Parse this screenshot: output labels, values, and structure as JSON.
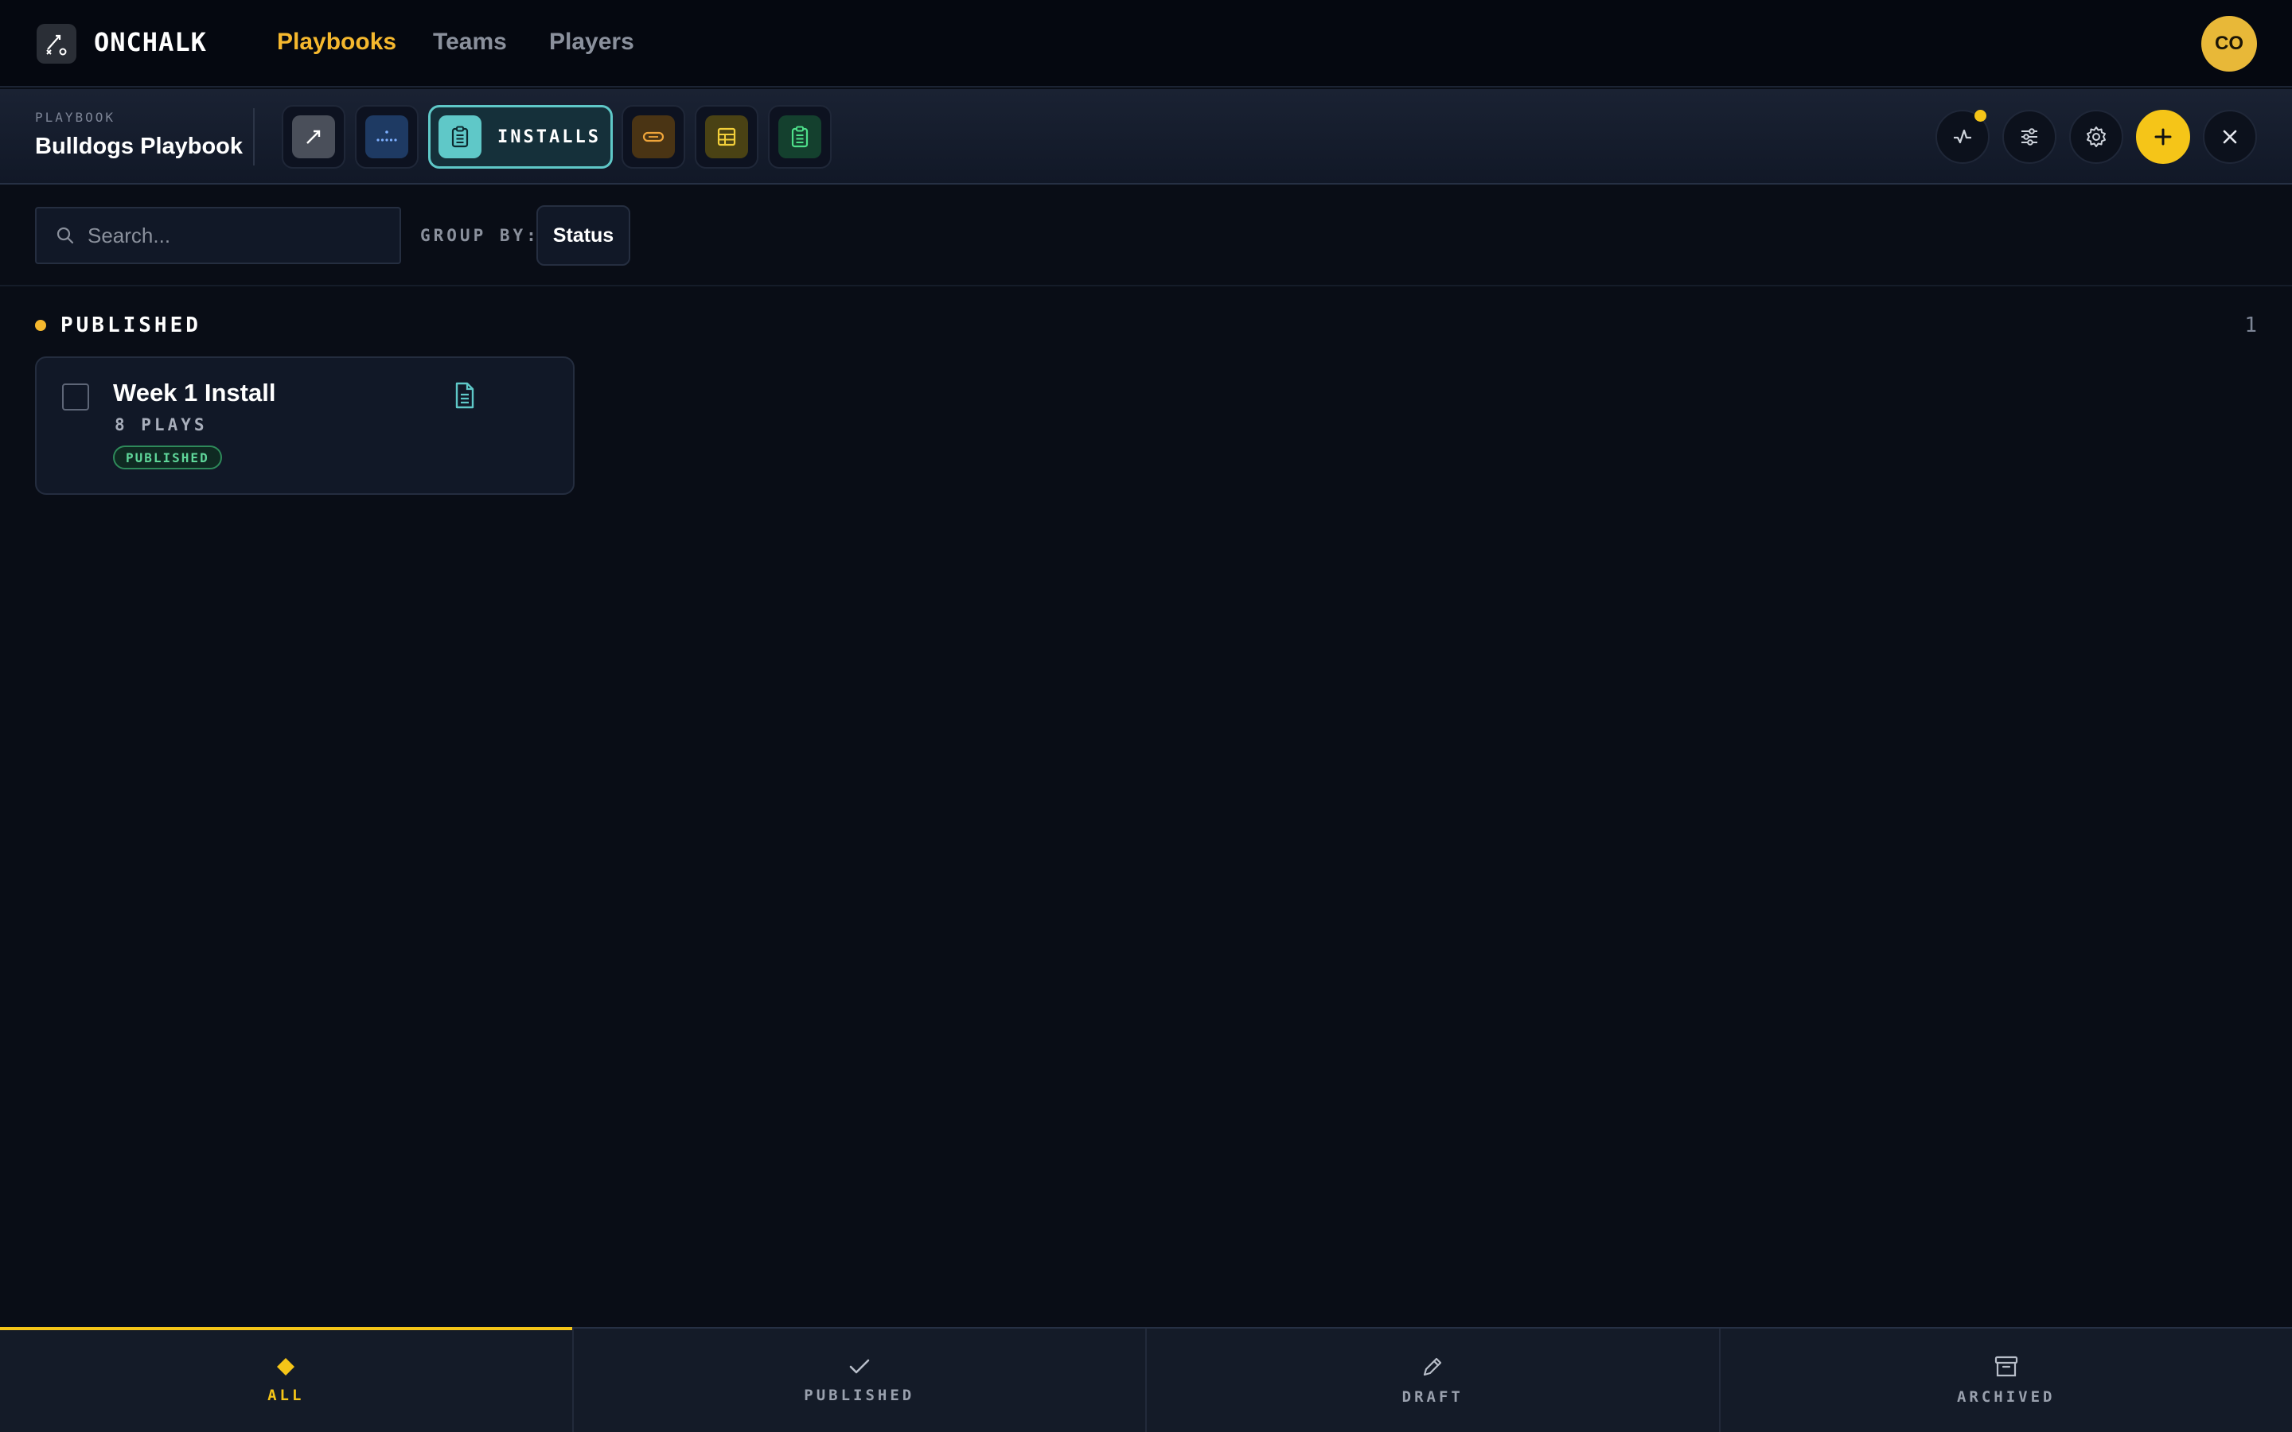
{
  "app": {
    "brand": "ONCHALK",
    "nav": [
      {
        "label": "Playbooks",
        "active": true
      },
      {
        "label": "Teams",
        "active": false
      },
      {
        "label": "Players",
        "active": false
      }
    ],
    "avatar_initials": "CO"
  },
  "toolbar": {
    "eyebrow": "PLAYBOOK",
    "title": "Bulldogs Playbook",
    "tools": [
      {
        "icon": "arrow-pen-icon",
        "color": "#4a4f5a"
      },
      {
        "icon": "formation-icon",
        "color": "#1e3a63"
      },
      {
        "icon": "clipboard-icon",
        "color": "#5fc8c8",
        "label": "INSTALLS",
        "active": true
      },
      {
        "icon": "wristband-icon",
        "color": "#4a3414"
      },
      {
        "icon": "table-icon",
        "color": "#4a4214"
      },
      {
        "icon": "clipboard-list-icon",
        "color": "#14402e"
      }
    ],
    "actions": [
      "activity-icon",
      "sliders-icon",
      "gear-icon",
      "plus-icon",
      "close-icon"
    ]
  },
  "filters": {
    "search_placeholder": "Search...",
    "group_by_label": "GROUP BY:",
    "group_by_value": "Status"
  },
  "section": {
    "title": "PUBLISHED",
    "count": "1",
    "accent": "#f5b82e"
  },
  "cards": [
    {
      "title": "Week 1 Install",
      "meta": "8 PLAYS",
      "status": "PUBLISHED"
    }
  ],
  "bottom_tabs": [
    {
      "label": "ALL",
      "icon": "diamond-icon",
      "active": true
    },
    {
      "label": "PUBLISHED",
      "icon": "check-icon",
      "active": false
    },
    {
      "label": "DRAFT",
      "icon": "pencil-icon",
      "active": false
    },
    {
      "label": "ARCHIVED",
      "icon": "archive-icon",
      "active": false
    }
  ]
}
